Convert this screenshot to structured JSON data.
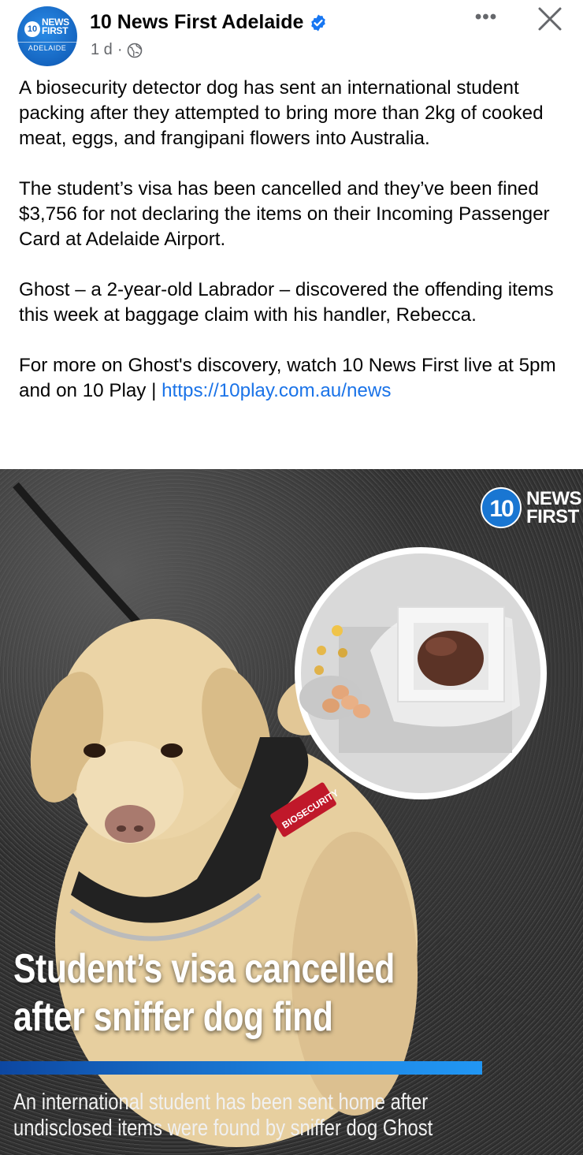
{
  "post": {
    "page_name": "10 News First Adelaide",
    "time": "1 d",
    "separator": "·",
    "more_label": "•••",
    "avatar": {
      "ten": "10",
      "line1": "NEWS",
      "line2": "FIRST",
      "location": "ADELAIDE"
    },
    "paragraphs": [
      "A biosecurity detector dog has sent an international student packing after they attempted to bring more than 2kg of cooked meat, eggs, and frangipani flowers into Australia.",
      "The student’s visa has been cancelled and they’ve been fined $3,756 for not declaring the items on their Incoming Passenger Card at Adelaide Airport.",
      "Ghost – a 2-year-old Labrador – discovered the offending items this week at baggage claim with his handler, Rebecca."
    ],
    "last_paragraph_text": "For more on Ghost's discovery, watch 10 News First live at 5pm and on 10 Play | ",
    "link": "https://10play.com.au/news"
  },
  "image": {
    "logo_ten": "10",
    "logo_line1": "NEWS",
    "logo_line2": "FIRST",
    "vest_label": "BIOSECURITY",
    "headline_line1": "Student’s visa cancelled",
    "headline_line2": "after sniffer dog find",
    "caption_line1": "An international student has been sent home after",
    "caption_line2": "undisclosed items were found by sniffer dog Ghost"
  },
  "colors": {
    "brand_blue": "#1976d2",
    "link_blue": "#1a73e8",
    "verified_blue": "#1877f2"
  },
  "icons": [
    "verified-badge-icon",
    "globe-icon",
    "more-options-icon",
    "close-icon"
  ]
}
